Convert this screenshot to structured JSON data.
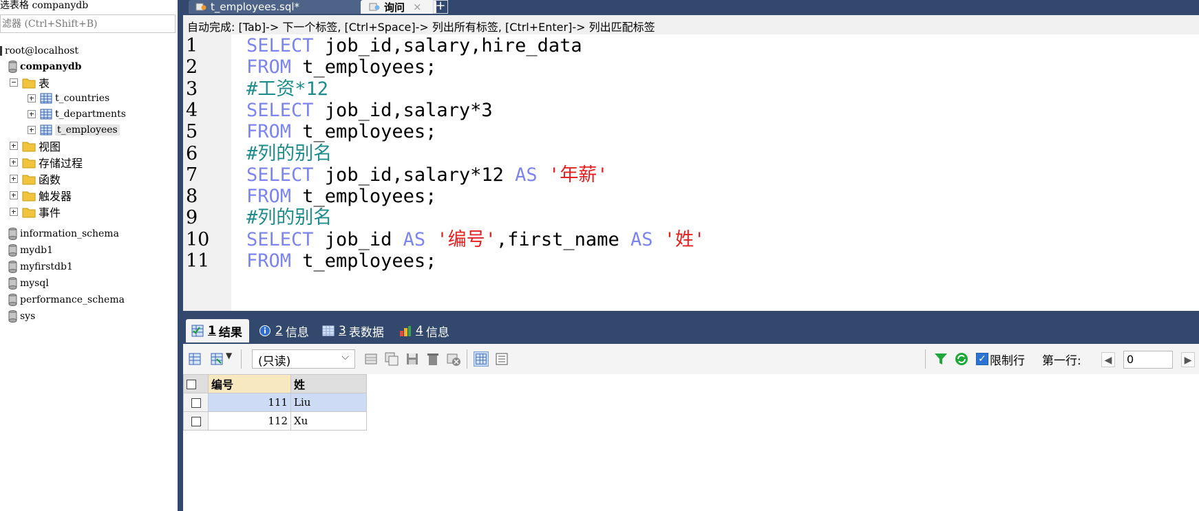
{
  "left_panel": {
    "db_label": "选表格 companydb",
    "filter_placeholder": "滤器 (Ctrl+Shift+B)",
    "connection": "root@localhost",
    "databases": [
      {
        "name": "companydb"
      },
      {
        "name": "information_schema"
      },
      {
        "name": "mydb1"
      },
      {
        "name": "myfirstdb1"
      },
      {
        "name": "mysql"
      },
      {
        "name": "performance_schema"
      },
      {
        "name": "sys"
      }
    ],
    "folders": {
      "tables": "表",
      "views": "视图",
      "procedures": "存储过程",
      "functions": "函数",
      "triggers": "触发器",
      "events": "事件"
    },
    "tables": [
      "t_countries",
      "t_departments",
      "t_employees"
    ]
  },
  "editor_tabs": [
    {
      "label": "t_employees.sql*"
    },
    {
      "label": "询问",
      "close": "×"
    }
  ],
  "new_tab_label": "+",
  "autocomplete_hint": "自动完成: [Tab]-> 下一个标签, [Ctrl+Space]-> 列出所有标签, [Ctrl+Enter]-> 列出匹配标签",
  "code_lines": [
    {
      "num": "1",
      "tokens": [
        [
          "kw",
          "SELECT"
        ],
        [
          "pl",
          " job_id,salary,hire_data"
        ]
      ]
    },
    {
      "num": "2",
      "tokens": [
        [
          "kw",
          "FROM"
        ],
        [
          "pl",
          " t_employees;"
        ]
      ]
    },
    {
      "num": "3",
      "tokens": [
        [
          "cm",
          "#工资*12"
        ]
      ]
    },
    {
      "num": "4",
      "tokens": [
        [
          "kw",
          "SELECT"
        ],
        [
          "pl",
          " job_id,salary*3"
        ]
      ]
    },
    {
      "num": "5",
      "tokens": [
        [
          "kw",
          "FROM"
        ],
        [
          "pl",
          " t_employees;"
        ]
      ]
    },
    {
      "num": "6",
      "tokens": [
        [
          "cm",
          "#列的别名"
        ]
      ]
    },
    {
      "num": "7",
      "tokens": [
        [
          "kw",
          "SELECT"
        ],
        [
          "pl",
          " job_id,salary*12 "
        ],
        [
          "kw",
          "AS"
        ],
        [
          "pl",
          " "
        ],
        [
          "st",
          "'年薪'"
        ]
      ]
    },
    {
      "num": "8",
      "tokens": [
        [
          "kw",
          "FROM"
        ],
        [
          "pl",
          " t_employees;"
        ]
      ]
    },
    {
      "num": "9",
      "tokens": [
        [
          "cm",
          "#列的别名"
        ]
      ]
    },
    {
      "num": "10",
      "tokens": [
        [
          "kw",
          "SELECT"
        ],
        [
          "pl",
          " job_id "
        ],
        [
          "kw",
          "AS"
        ],
        [
          "pl",
          " "
        ],
        [
          "st",
          "'编号'"
        ],
        [
          "pl",
          ",first_name "
        ],
        [
          "kw",
          "AS"
        ],
        [
          "pl",
          " "
        ],
        [
          "st",
          "'姓'"
        ]
      ]
    },
    {
      "num": "11",
      "tokens": [
        [
          "kw",
          "FROM"
        ],
        [
          "pl",
          " t_employees;"
        ]
      ]
    }
  ],
  "result_tabs": [
    {
      "num": "1",
      "label": "结果",
      "selected": true
    },
    {
      "num": "2",
      "label": "信息",
      "selected": false
    },
    {
      "num": "3",
      "label": "表数据",
      "selected": false
    },
    {
      "num": "4",
      "label": "信息",
      "selected": false
    }
  ],
  "result_toolbar": {
    "mode_select": "(只读)",
    "limit_rows_label": "限制行",
    "limit_rows_checked": true,
    "first_row_label": "第一行:",
    "first_row_value": "0"
  },
  "result_grid": {
    "columns": [
      "编号",
      "姓"
    ],
    "rows": [
      [
        "111",
        "Liu"
      ],
      [
        "112",
        "Xu"
      ]
    ]
  },
  "colors": {
    "keyword": "#7c84ef",
    "comment": "#1e8c8c",
    "string": "#e62020",
    "chrome_dark": "#33486d",
    "selection": "#cddcf4"
  }
}
